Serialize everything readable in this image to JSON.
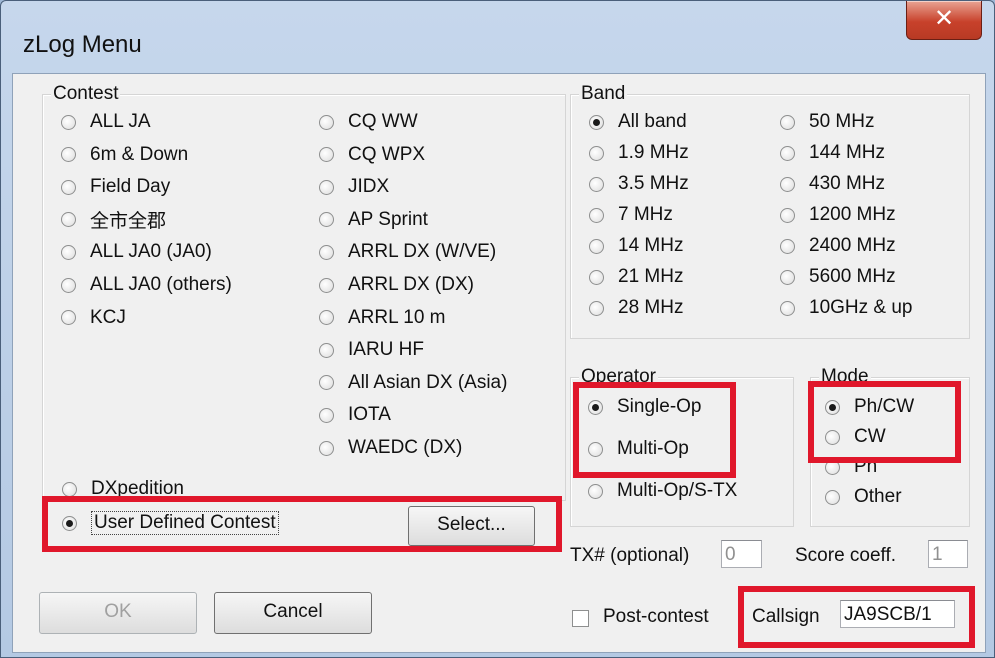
{
  "window": {
    "title": "zLog Menu",
    "close_glyph": "✕",
    "close_icon": "close-icon"
  },
  "contest": {
    "label": "Contest",
    "col1": [
      "ALL JA",
      "6m & Down",
      "Field Day",
      "全市全郡",
      "ALL JA0 (JA0)",
      "ALL JA0 (others)",
      "KCJ"
    ],
    "col2": [
      "CQ WW",
      "CQ WPX",
      "JIDX",
      "AP Sprint",
      "ARRL DX (W/VE)",
      "ARRL DX (DX)",
      "ARRL 10 m",
      "IARU HF",
      "All Asian DX (Asia)",
      "IOTA",
      "WAEDC (DX)"
    ],
    "dxpedition": "DXpedition",
    "user_defined": "User Defined Contest",
    "selected": "User Defined Contest",
    "select_button": "Select..."
  },
  "band": {
    "label": "Band",
    "col1": [
      "All band",
      "1.9 MHz",
      "3.5 MHz",
      "7 MHz",
      "14 MHz",
      "21 MHz",
      "28 MHz"
    ],
    "col2": [
      "50 MHz",
      "144 MHz",
      "430 MHz",
      "1200 MHz",
      "2400 MHz",
      "5600 MHz",
      "10GHz & up"
    ],
    "selected": "All band"
  },
  "operator": {
    "label": "Operator",
    "options": [
      "Single-Op",
      "Multi-Op",
      "Multi-Op/S-TX"
    ],
    "selected": "Single-Op"
  },
  "mode": {
    "label": "Mode",
    "options": [
      "Ph/CW",
      "CW",
      "Ph",
      "Other"
    ],
    "selected": "Ph/CW"
  },
  "tx": {
    "label": "TX# (optional)",
    "value": "0"
  },
  "score": {
    "label": "Score coeff.",
    "value": "1"
  },
  "post_contest": {
    "label": "Post-contest",
    "checked": false
  },
  "callsign": {
    "label": "Callsign",
    "value": "JA9SCB/1"
  },
  "buttons": {
    "ok": "OK",
    "cancel": "Cancel"
  },
  "colors": {
    "highlight": "#e0172b",
    "title_bg": "#b9cde6",
    "close_red": "#c8412b"
  }
}
